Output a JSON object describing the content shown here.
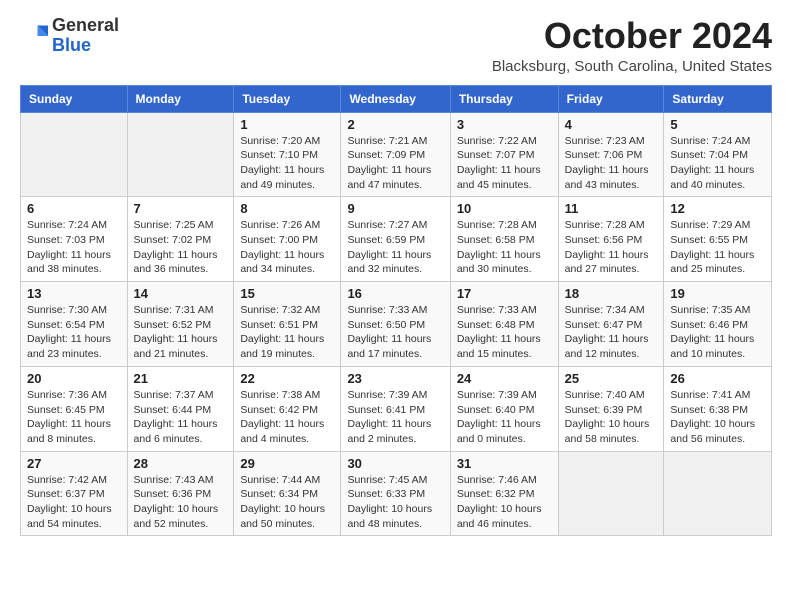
{
  "logo": {
    "general": "General",
    "blue": "Blue"
  },
  "title": {
    "month_year": "October 2024",
    "location": "Blacksburg, South Carolina, United States"
  },
  "days_of_week": [
    "Sunday",
    "Monday",
    "Tuesday",
    "Wednesday",
    "Thursday",
    "Friday",
    "Saturday"
  ],
  "weeks": [
    [
      {
        "day": "",
        "info": ""
      },
      {
        "day": "",
        "info": ""
      },
      {
        "day": "1",
        "info": "Sunrise: 7:20 AM\nSunset: 7:10 PM\nDaylight: 11 hours and 49 minutes."
      },
      {
        "day": "2",
        "info": "Sunrise: 7:21 AM\nSunset: 7:09 PM\nDaylight: 11 hours and 47 minutes."
      },
      {
        "day": "3",
        "info": "Sunrise: 7:22 AM\nSunset: 7:07 PM\nDaylight: 11 hours and 45 minutes."
      },
      {
        "day": "4",
        "info": "Sunrise: 7:23 AM\nSunset: 7:06 PM\nDaylight: 11 hours and 43 minutes."
      },
      {
        "day": "5",
        "info": "Sunrise: 7:24 AM\nSunset: 7:04 PM\nDaylight: 11 hours and 40 minutes."
      }
    ],
    [
      {
        "day": "6",
        "info": "Sunrise: 7:24 AM\nSunset: 7:03 PM\nDaylight: 11 hours and 38 minutes."
      },
      {
        "day": "7",
        "info": "Sunrise: 7:25 AM\nSunset: 7:02 PM\nDaylight: 11 hours and 36 minutes."
      },
      {
        "day": "8",
        "info": "Sunrise: 7:26 AM\nSunset: 7:00 PM\nDaylight: 11 hours and 34 minutes."
      },
      {
        "day": "9",
        "info": "Sunrise: 7:27 AM\nSunset: 6:59 PM\nDaylight: 11 hours and 32 minutes."
      },
      {
        "day": "10",
        "info": "Sunrise: 7:28 AM\nSunset: 6:58 PM\nDaylight: 11 hours and 30 minutes."
      },
      {
        "day": "11",
        "info": "Sunrise: 7:28 AM\nSunset: 6:56 PM\nDaylight: 11 hours and 27 minutes."
      },
      {
        "day": "12",
        "info": "Sunrise: 7:29 AM\nSunset: 6:55 PM\nDaylight: 11 hours and 25 minutes."
      }
    ],
    [
      {
        "day": "13",
        "info": "Sunrise: 7:30 AM\nSunset: 6:54 PM\nDaylight: 11 hours and 23 minutes."
      },
      {
        "day": "14",
        "info": "Sunrise: 7:31 AM\nSunset: 6:52 PM\nDaylight: 11 hours and 21 minutes."
      },
      {
        "day": "15",
        "info": "Sunrise: 7:32 AM\nSunset: 6:51 PM\nDaylight: 11 hours and 19 minutes."
      },
      {
        "day": "16",
        "info": "Sunrise: 7:33 AM\nSunset: 6:50 PM\nDaylight: 11 hours and 17 minutes."
      },
      {
        "day": "17",
        "info": "Sunrise: 7:33 AM\nSunset: 6:48 PM\nDaylight: 11 hours and 15 minutes."
      },
      {
        "day": "18",
        "info": "Sunrise: 7:34 AM\nSunset: 6:47 PM\nDaylight: 11 hours and 12 minutes."
      },
      {
        "day": "19",
        "info": "Sunrise: 7:35 AM\nSunset: 6:46 PM\nDaylight: 11 hours and 10 minutes."
      }
    ],
    [
      {
        "day": "20",
        "info": "Sunrise: 7:36 AM\nSunset: 6:45 PM\nDaylight: 11 hours and 8 minutes."
      },
      {
        "day": "21",
        "info": "Sunrise: 7:37 AM\nSunset: 6:44 PM\nDaylight: 11 hours and 6 minutes."
      },
      {
        "day": "22",
        "info": "Sunrise: 7:38 AM\nSunset: 6:42 PM\nDaylight: 11 hours and 4 minutes."
      },
      {
        "day": "23",
        "info": "Sunrise: 7:39 AM\nSunset: 6:41 PM\nDaylight: 11 hours and 2 minutes."
      },
      {
        "day": "24",
        "info": "Sunrise: 7:39 AM\nSunset: 6:40 PM\nDaylight: 11 hours and 0 minutes."
      },
      {
        "day": "25",
        "info": "Sunrise: 7:40 AM\nSunset: 6:39 PM\nDaylight: 10 hours and 58 minutes."
      },
      {
        "day": "26",
        "info": "Sunrise: 7:41 AM\nSunset: 6:38 PM\nDaylight: 10 hours and 56 minutes."
      }
    ],
    [
      {
        "day": "27",
        "info": "Sunrise: 7:42 AM\nSunset: 6:37 PM\nDaylight: 10 hours and 54 minutes."
      },
      {
        "day": "28",
        "info": "Sunrise: 7:43 AM\nSunset: 6:36 PM\nDaylight: 10 hours and 52 minutes."
      },
      {
        "day": "29",
        "info": "Sunrise: 7:44 AM\nSunset: 6:34 PM\nDaylight: 10 hours and 50 minutes."
      },
      {
        "day": "30",
        "info": "Sunrise: 7:45 AM\nSunset: 6:33 PM\nDaylight: 10 hours and 48 minutes."
      },
      {
        "day": "31",
        "info": "Sunrise: 7:46 AM\nSunset: 6:32 PM\nDaylight: 10 hours and 46 minutes."
      },
      {
        "day": "",
        "info": ""
      },
      {
        "day": "",
        "info": ""
      }
    ]
  ]
}
